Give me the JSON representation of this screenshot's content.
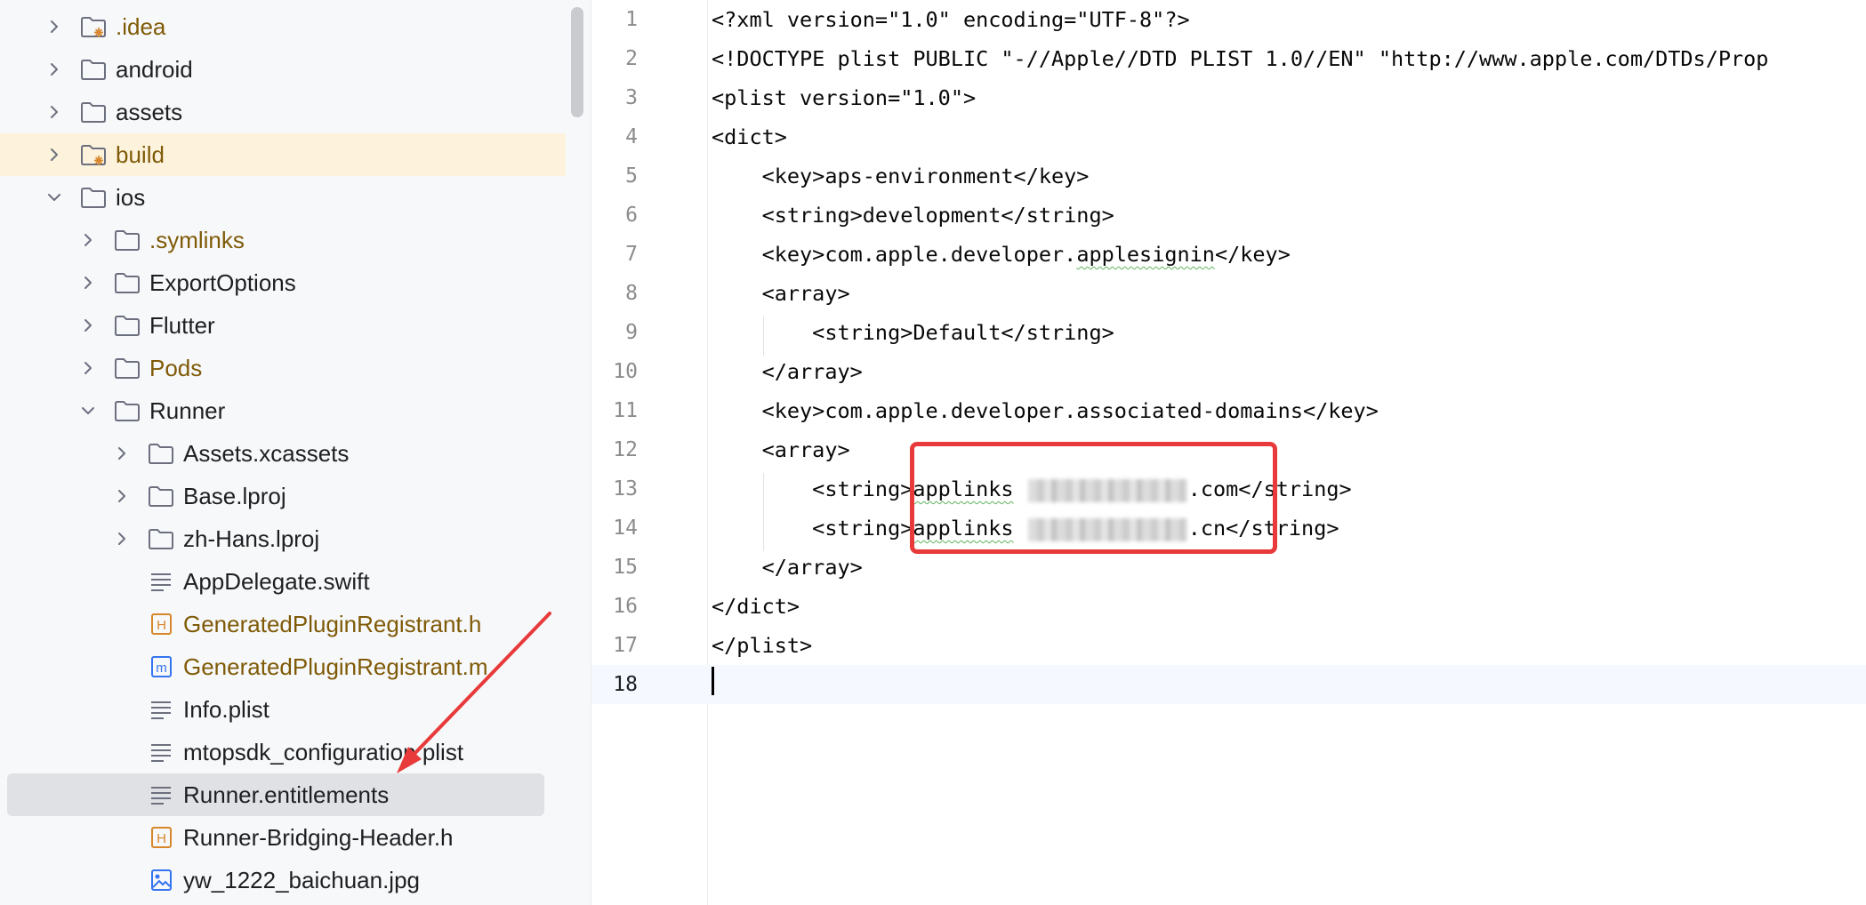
{
  "project_tree": {
    "items": [
      {
        "label": ".idea",
        "chevron": "right",
        "icon": "folder-excluded-icon",
        "excluded": true
      },
      {
        "label": "android",
        "chevron": "right",
        "icon": "folder-icon"
      },
      {
        "label": "assets",
        "chevron": "right",
        "icon": "folder-icon"
      },
      {
        "label": "build",
        "chevron": "right",
        "icon": "folder-excluded-icon",
        "excluded": true,
        "tinted": true
      },
      {
        "label": "ios",
        "chevron": "down",
        "icon": "folder-icon"
      },
      {
        "label": ".symlinks",
        "chevron": "right",
        "icon": "folder-icon",
        "excluded": true
      },
      {
        "label": "ExportOptions",
        "chevron": "right",
        "icon": "folder-icon"
      },
      {
        "label": "Flutter",
        "chevron": "right",
        "icon": "folder-icon"
      },
      {
        "label": "Pods",
        "chevron": "right",
        "icon": "folder-icon",
        "excluded": true
      },
      {
        "label": "Runner",
        "chevron": "down",
        "icon": "folder-icon"
      },
      {
        "label": "Assets.xcassets",
        "chevron": "right",
        "icon": "folder-icon"
      },
      {
        "label": "Base.lproj",
        "chevron": "right",
        "icon": "folder-icon"
      },
      {
        "label": "zh-Hans.lproj",
        "chevron": "right",
        "icon": "folder-icon"
      },
      {
        "label": "AppDelegate.swift",
        "chevron": "none",
        "icon": "text-file-icon"
      },
      {
        "label": "GeneratedPluginRegistrant.h",
        "chevron": "none",
        "icon": "header-file-icon",
        "excluded": true
      },
      {
        "label": "GeneratedPluginRegistrant.m",
        "chevron": "none",
        "icon": "objc-file-icon",
        "excluded": true
      },
      {
        "label": "Info.plist",
        "chevron": "none",
        "icon": "text-file-icon"
      },
      {
        "label": "mtopsdk_configuration.plist",
        "chevron": "none",
        "icon": "text-file-icon"
      },
      {
        "label": "Runner.entitlements",
        "chevron": "none",
        "icon": "text-file-icon",
        "selected": true
      },
      {
        "label": "Runner-Bridging-Header.h",
        "chevron": "none",
        "icon": "header-file-icon"
      },
      {
        "label": "yw_1222_baichuan.jpg",
        "chevron": "none",
        "icon": "image-file-icon"
      }
    ]
  },
  "editor": {
    "current_line": 18,
    "lines": [
      {
        "n": "1",
        "code": "<?xml version=\"1.0\" encoding=\"UTF-8\"?>"
      },
      {
        "n": "2",
        "code": "<!DOCTYPE plist PUBLIC \"-//Apple//DTD PLIST 1.0//EN\" \"http://www.apple.com/DTDs/Prop"
      },
      {
        "n": "3",
        "code": "<plist version=\"1.0\">"
      },
      {
        "n": "4",
        "code": "<dict>"
      },
      {
        "n": "5",
        "code": "    <key>aps-environment</key>"
      },
      {
        "n": "6",
        "code": "    <string>development</string>"
      },
      {
        "n": "7",
        "pre": "    <key>com.apple.developer.",
        "squiggle": "applesignin",
        "post": "</key>"
      },
      {
        "n": "8",
        "code": "    <array>"
      },
      {
        "n": "9",
        "code": "        <string>Default</string>"
      },
      {
        "n": "10",
        "code": "    </array>"
      },
      {
        "n": "11",
        "code": "    <key>com.apple.developer.associated-domains</key>"
      },
      {
        "n": "12",
        "code": "    <array>"
      },
      {
        "n": "13",
        "pre": "        <string>",
        "squiggle": "applinks",
        "post": ".com</string>",
        "redacted": true
      },
      {
        "n": "14",
        "pre": "        <string>",
        "squiggle": "applinks",
        "post": ".cn</string>",
        "redacted": true
      },
      {
        "n": "15",
        "code": "    </array>"
      },
      {
        "n": "16",
        "code": "</dict>"
      },
      {
        "n": "17",
        "code": "</plist>"
      },
      {
        "n": "18",
        "code": ""
      }
    ]
  },
  "colors": {
    "annotation": "#e83a3a",
    "excluded_text": "#7f5a07",
    "selection": "#dfe1e5",
    "tint": "#fdf3dc"
  }
}
